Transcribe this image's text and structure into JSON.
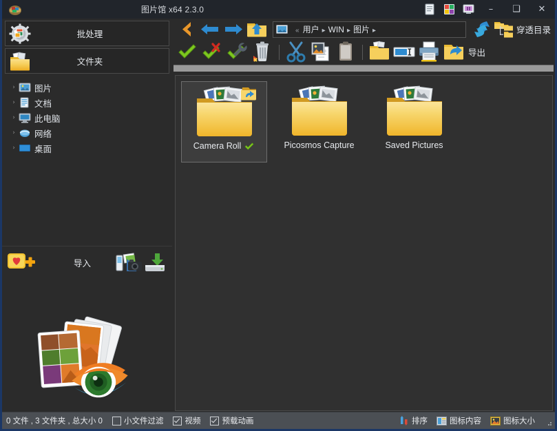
{
  "window": {
    "title": "图片馆 x64 2.3.0",
    "app_icon": "picture-library-icon",
    "header_icons": [
      {
        "name": "document-icon",
        "label": "文档"
      },
      {
        "name": "color-palette-icon",
        "label": "调色板"
      },
      {
        "name": "screen-capture-icon",
        "label": "截屏"
      }
    ],
    "controls": {
      "minimize": "–",
      "maximize": "❑",
      "close": "✕"
    }
  },
  "sidebar": {
    "buttons": [
      {
        "label": "批处理",
        "icon": "batch-gear-photos-icon"
      },
      {
        "label": "文件夹",
        "icon": "folder-photos-icon"
      }
    ],
    "tree": [
      {
        "label": "图片",
        "icon": "pictures-icon",
        "arrow": "›"
      },
      {
        "label": "文档",
        "icon": "documents-icon",
        "arrow": "›"
      },
      {
        "label": "此电脑",
        "icon": "this-pc-icon",
        "arrow": "›"
      },
      {
        "label": "网络",
        "icon": "network-icon",
        "arrow": "›"
      },
      {
        "label": "桌面",
        "icon": "desktop-icon",
        "arrow": "›"
      }
    ],
    "import": {
      "favorite_icon": "add-favorite-icon",
      "label": "导入",
      "camera_icon": "camera-import-icon",
      "disk_icon": "disk-import-icon"
    },
    "logo": "picosmos-photos-eye-logo"
  },
  "nav": {
    "back_icon": "back-chevron-icon",
    "prev_icon": "arrow-left-icon",
    "next_icon": "arrow-right-icon",
    "up_icon": "folder-up-icon",
    "address": {
      "icon": "picture-folder-icon",
      "prefix": "«",
      "crumbs": [
        "用户",
        "WIN",
        "图片"
      ],
      "placeholder": ""
    },
    "refresh_icon": "refresh-sync-icon",
    "penetrate": {
      "label": "穿透目录",
      "icon": "folder-tree-icon"
    }
  },
  "toolbar": {
    "items": [
      {
        "name": "select-all-check",
        "icon": "green-check-icon",
        "label": ""
      },
      {
        "name": "deselect-check",
        "icon": "check-with-red-x-icon",
        "label": ""
      },
      {
        "name": "select-options-check",
        "icon": "check-with-wrench-icon",
        "label": ""
      },
      {
        "name": "delete-button",
        "icon": "trash-icon",
        "label": ""
      },
      {
        "name": "separator-1",
        "icon": "separator",
        "label": ""
      },
      {
        "name": "cut-button",
        "icon": "scissors-icon",
        "label": ""
      },
      {
        "name": "copy-button",
        "icon": "copy-image-icon",
        "label": ""
      },
      {
        "name": "paste-button",
        "icon": "clipboard-icon",
        "label": ""
      },
      {
        "name": "separator-2",
        "icon": "separator",
        "label": ""
      },
      {
        "name": "new-folder-button",
        "icon": "folder-icon",
        "label": ""
      },
      {
        "name": "rename-button",
        "icon": "rename-field-icon",
        "label": ""
      },
      {
        "name": "print-button",
        "icon": "printer-icon",
        "label": ""
      },
      {
        "name": "export-button",
        "icon": "folder-export-icon",
        "label": "导出"
      }
    ],
    "export_label": "导出"
  },
  "files": {
    "items": [
      {
        "name": "Camera Roll",
        "selected": true,
        "checked": true,
        "badge": "folder-sync-badge"
      },
      {
        "name": "Picosmos Capture",
        "selected": false,
        "checked": false,
        "badge": ""
      },
      {
        "name": "Saved Pictures",
        "selected": false,
        "checked": false,
        "badge": ""
      }
    ]
  },
  "statusbar": {
    "summary": "0 文件 , 3 文件夹 , 总大小 0",
    "checkboxes": [
      {
        "label": "小文件过滤",
        "checked": false
      },
      {
        "label": "视频",
        "checked": true
      },
      {
        "label": "预载动画",
        "checked": true
      }
    ],
    "right_items": [
      {
        "label": "排序",
        "icon": "sort-icon"
      },
      {
        "label": "图标内容",
        "icon": "icon-content-icon"
      },
      {
        "label": "图标大小",
        "icon": "icon-size-icon"
      }
    ]
  },
  "colors": {
    "window_border": "#1b3766",
    "titlebar": "#21252b",
    "panel": "#2b2b2b",
    "filearea": "#303030",
    "statusbar": "#4b4f54",
    "accent_folder": "#f6cf5c",
    "accent_check": "#7ec820",
    "accent_blue": "#2e8bd0"
  }
}
